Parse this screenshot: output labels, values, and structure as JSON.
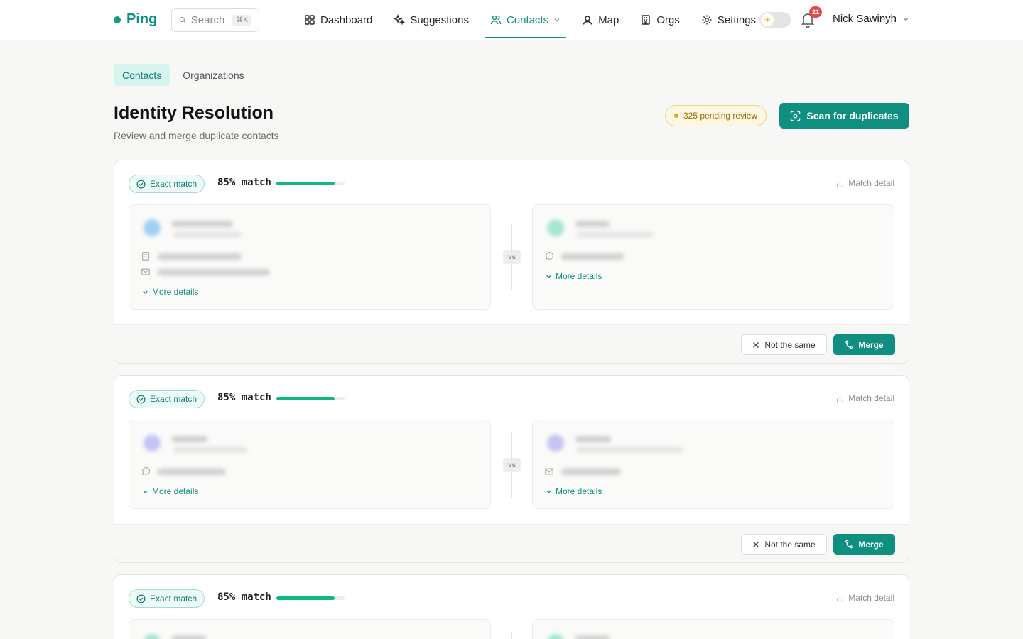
{
  "header": {
    "logo": "Ping",
    "search_placeholder": "Search",
    "search_shortcut": "⌘K",
    "nav": [
      {
        "label": "Dashboard",
        "icon": "grid-icon"
      },
      {
        "label": "Suggestions",
        "icon": "sparkle-icon"
      },
      {
        "label": "Contacts",
        "icon": "users-icon",
        "active": true
      },
      {
        "label": "Map",
        "icon": "map-pin-icon"
      },
      {
        "label": "Orgs",
        "icon": "building-icon"
      },
      {
        "label": "Settings",
        "icon": "gear-icon"
      }
    ],
    "notifications_count": "21",
    "user_name": "Nick Sawinyh"
  },
  "subtabs": [
    "Contacts",
    "Organizations"
  ],
  "page": {
    "title": "Identity Resolution",
    "subtitle": "Review and merge duplicate contacts",
    "pending_label": "325 pending review",
    "scan_button": "Scan for duplicates"
  },
  "colors": {
    "accent": "#0e8f80",
    "progress": "#10b981",
    "pending": "#e8a10a"
  },
  "cards": [
    {
      "badge": "Exact match",
      "score": "85% match",
      "score_fraction": 0.85,
      "detail": "Match detail",
      "vs": "vs",
      "more": "More details",
      "not_same": "Not the same",
      "merge": "Merge"
    },
    {
      "badge": "Exact match",
      "score": "85% match",
      "score_fraction": 0.85,
      "detail": "Match detail",
      "vs": "vs",
      "more": "More details",
      "not_same": "Not the same",
      "merge": "Merge"
    },
    {
      "badge": "Exact match",
      "score": "85% match",
      "score_fraction": 0.85,
      "detail": "Match detail"
    }
  ]
}
